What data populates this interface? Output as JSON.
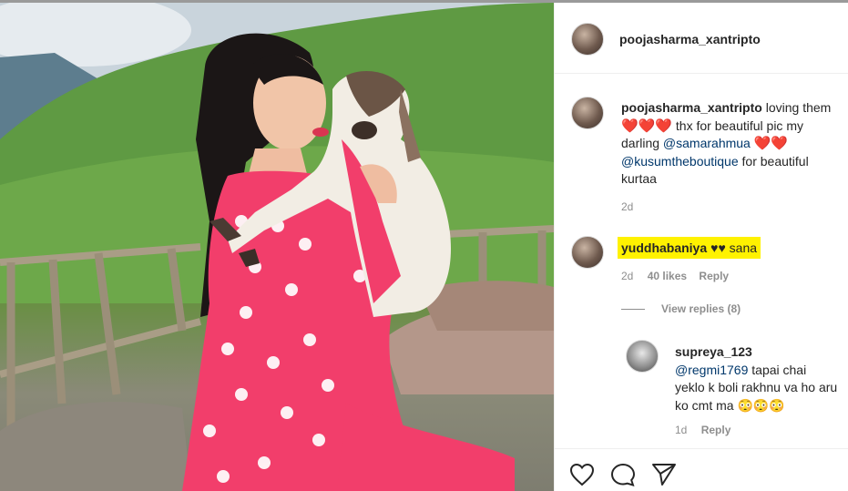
{
  "post": {
    "username": "poojasharma_xantripto"
  },
  "caption": {
    "username": "poojasharma_xantripto",
    "text_1": "loving them",
    "hearts_1": "❤️❤️❤️",
    "text_2": "thx for beautiful pic my darling",
    "mention_1": "@samarahmua",
    "hearts_2": "❤️❤️",
    "mention_2": "@kusumtheboutique",
    "text_3": "for beautiful kurtaa",
    "time": "2d"
  },
  "comments": [
    {
      "username": "yuddhabaniya",
      "text": "♥♥ sana",
      "time": "2d",
      "likes": "40 likes",
      "reply_label": "Reply",
      "view_replies": "View replies (8)",
      "highlight_color": "#fff200"
    },
    {
      "username": "supreya_123",
      "mention": "@regmi1769",
      "text": "tapai chai yeklo k boli rakhnu va ho aru ko cmt ma",
      "emojis": "😳😳😳",
      "time": "1d",
      "reply_label": "Reply"
    }
  ],
  "actions": {
    "like_icon": "heart-outline-icon",
    "comment_icon": "comment-bubble-icon",
    "share_icon": "paper-plane-icon"
  }
}
